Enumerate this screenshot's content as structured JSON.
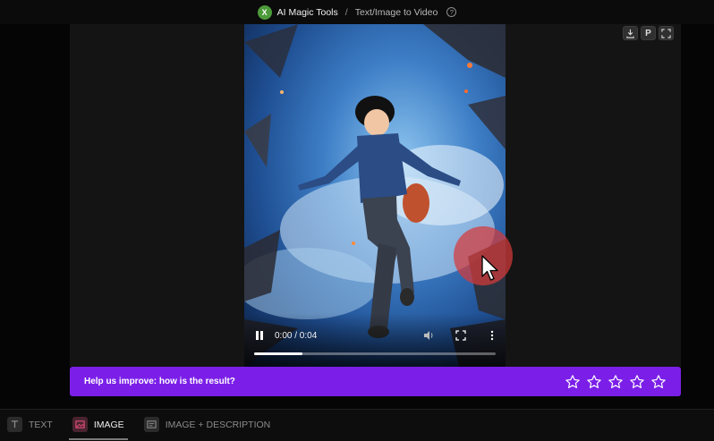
{
  "header": {
    "logo_letter": "X",
    "app_name": "AI Magic Tools",
    "separator": "/",
    "page_name": "Text/Image to Video",
    "help_glyph": "?"
  },
  "toolbar": {
    "icons": [
      "download-icon",
      "pin-icon",
      "fullscreen-icon"
    ],
    "pin_glyph": "P"
  },
  "video": {
    "time_display": "0:00 / 0:04",
    "progress_fraction": 0.2,
    "state": "playing"
  },
  "feedback": {
    "prompt": "Help us improve: how is the result?",
    "max_stars": 5
  },
  "tabs": [
    {
      "label": "TEXT",
      "active": false
    },
    {
      "label": "IMAGE",
      "active": true
    },
    {
      "label": "IMAGE + DESCRIPTION",
      "active": false
    }
  ],
  "colors": {
    "accent": "#7b1fe8",
    "logo": "#4c9a3a",
    "cursor_highlight": "#d63a3a"
  }
}
